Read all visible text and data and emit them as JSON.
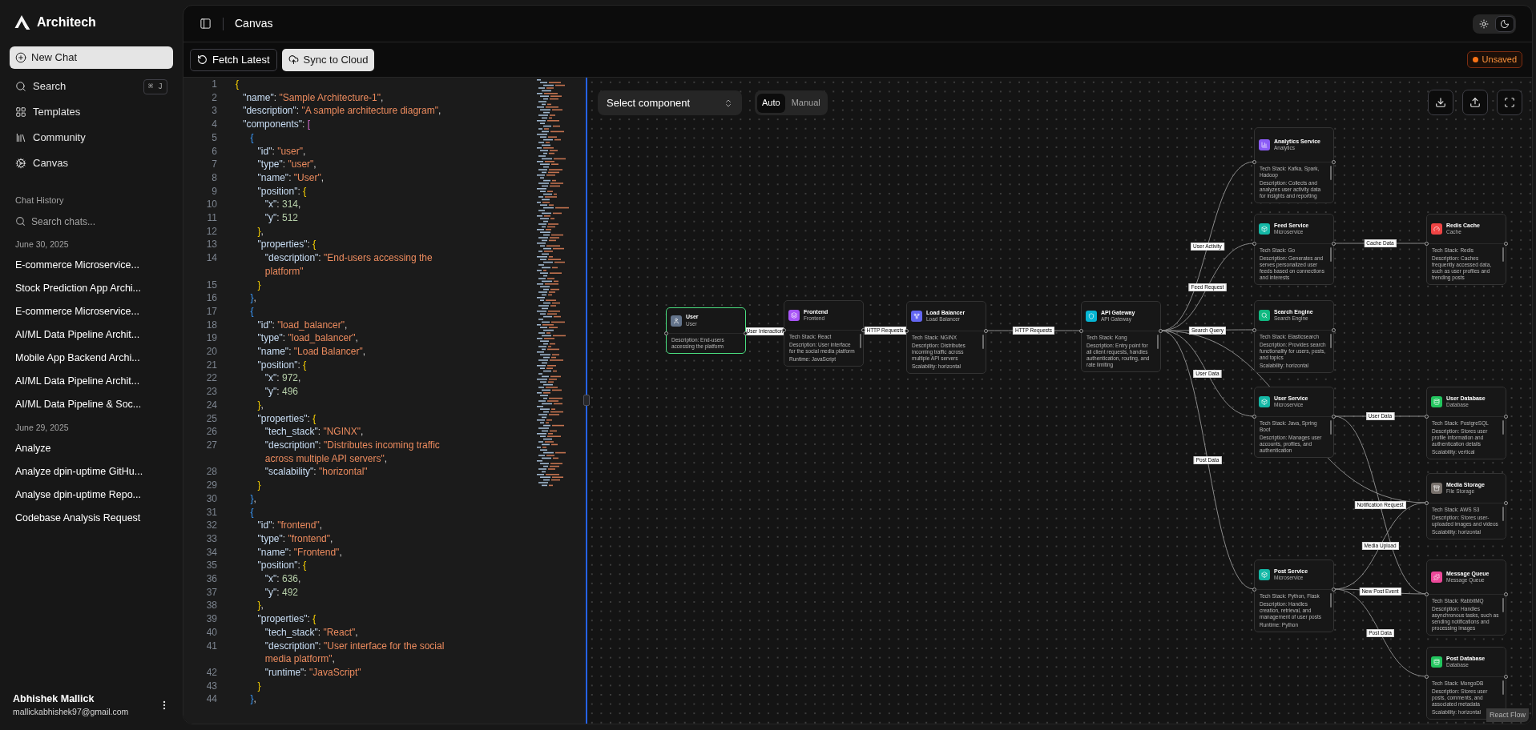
{
  "app": {
    "name": "Architech"
  },
  "sidebar": {
    "new_chat": "New Chat",
    "nav": [
      {
        "kind": "search",
        "label": "Search",
        "shortcut": "⌘ J"
      },
      {
        "kind": "templates",
        "label": "Templates"
      },
      {
        "kind": "community",
        "label": "Community"
      },
      {
        "kind": "canvas",
        "label": "Canvas"
      }
    ],
    "history_title": "Chat History",
    "search_placeholder": "Search chats...",
    "groups": [
      {
        "date": "June 30, 2025",
        "chats": [
          "E-commerce Microservice...",
          "Stock Prediction App Archi...",
          "E-commerce Microservice...",
          "AI/ML Data Pipeline Archit...",
          "Mobile App Backend Archi...",
          "AI/ML Data Pipeline Archit...",
          "AI/ML Data Pipeline & Soc..."
        ]
      },
      {
        "date": "June 29, 2025",
        "chats": [
          "Analyze",
          "Analyze dpin-uptime GitHu...",
          "Analyse dpin-uptime Repo...",
          "Codebase Analysis Request"
        ]
      }
    ],
    "user": {
      "name": "Abhishek Mallick",
      "email": "mallickabhishek97@gmail.com"
    }
  },
  "header": {
    "title": "Canvas",
    "theme_options": [
      {
        "kind": "light",
        "selected": false
      },
      {
        "kind": "dark",
        "selected": true
      }
    ]
  },
  "toolbar": {
    "buttons": [
      {
        "kind": "fetch",
        "label": "Fetch Latest",
        "primary": false
      },
      {
        "kind": "sync",
        "label": "Sync to Cloud",
        "primary": true
      }
    ],
    "status": "Unsaved"
  },
  "editor": {
    "lines": [
      {
        "n": "1",
        "text": "{"
      },
      {
        "n": "2",
        "text": "  \"name\": \"Sample Architecture-1\","
      },
      {
        "n": "3",
        "text": "  \"description\": \"A sample architecture diagram\","
      },
      {
        "n": "4",
        "text": "  \"components\": ["
      },
      {
        "n": "5",
        "text": "    {"
      },
      {
        "n": "6",
        "text": "      \"id\": \"user\","
      },
      {
        "n": "7",
        "text": "      \"type\": \"user\","
      },
      {
        "n": "8",
        "text": "      \"name\": \"User\","
      },
      {
        "n": "9",
        "text": "      \"position\": {"
      },
      {
        "n": "10",
        "text": "        \"x\": 314,"
      },
      {
        "n": "11",
        "text": "        \"y\": 512"
      },
      {
        "n": "12",
        "text": "      },"
      },
      {
        "n": "13",
        "text": "      \"properties\": {"
      },
      {
        "n": "14",
        "text": "        \"description\": \"End-users accessing the platform\""
      },
      {
        "n": "15",
        "text": "      }"
      },
      {
        "n": "16",
        "text": "    },"
      },
      {
        "n": "17",
        "text": "    {"
      },
      {
        "n": "18",
        "text": "      \"id\": \"load_balancer\","
      },
      {
        "n": "19",
        "text": "      \"type\": \"load_balancer\","
      },
      {
        "n": "20",
        "text": "      \"name\": \"Load Balancer\","
      },
      {
        "n": "21",
        "text": "      \"position\": {"
      },
      {
        "n": "22",
        "text": "        \"x\": 972,"
      },
      {
        "n": "23",
        "text": "        \"y\": 496"
      },
      {
        "n": "24",
        "text": "      },"
      },
      {
        "n": "25",
        "text": "      \"properties\": {"
      },
      {
        "n": "26",
        "text": "        \"tech_stack\": \"NGINX\","
      },
      {
        "n": "27",
        "text": "        \"description\": \"Distributes incoming traffic across multiple API servers\","
      },
      {
        "n": "28",
        "text": "        \"scalability\": \"horizontal\""
      },
      {
        "n": "29",
        "text": "      }"
      },
      {
        "n": "30",
        "text": "    },"
      },
      {
        "n": "31",
        "text": "    {"
      },
      {
        "n": "32",
        "text": "      \"id\": \"frontend\","
      },
      {
        "n": "33",
        "text": "      \"type\": \"frontend\","
      },
      {
        "n": "34",
        "text": "      \"name\": \"Frontend\","
      },
      {
        "n": "35",
        "text": "      \"position\": {"
      },
      {
        "n": "36",
        "text": "        \"x\": 636,"
      },
      {
        "n": "37",
        "text": "        \"y\": 492"
      },
      {
        "n": "38",
        "text": "      },"
      },
      {
        "n": "39",
        "text": "      \"properties\": {"
      },
      {
        "n": "40",
        "text": "        \"tech_stack\": \"React\","
      },
      {
        "n": "41",
        "text": "        \"description\": \"User interface for the social media platform\","
      },
      {
        "n": "42",
        "text": "        \"runtime\": \"JavaScript\""
      },
      {
        "n": "43",
        "text": "      }"
      },
      {
        "n": "44",
        "text": "    },"
      }
    ]
  },
  "canvas": {
    "component_select": {
      "placeholder": "Select component"
    },
    "layout_modes": [
      {
        "label": "Auto",
        "selected": true
      },
      {
        "label": "Manual",
        "selected": false
      }
    ],
    "nodes": [
      {
        "title": "User",
        "subtitle": "User",
        "kind": "user",
        "color": "#64748b",
        "selected": true,
        "details": [
          "Description: End-users accessing the platform"
        ]
      },
      {
        "title": "Frontend",
        "subtitle": "Frontend",
        "kind": "frontend",
        "color": "#a855f7",
        "selected": false,
        "details": [
          "Tech Stack: React",
          "Description: User interface for the social media platform",
          "Runtime: JavaScript"
        ]
      },
      {
        "title": "Load Balancer",
        "subtitle": "Load Balancer",
        "kind": "load_balancer",
        "color": "#6366f1",
        "selected": false,
        "details": [
          "Tech Stack: NGINX",
          "Description: Distributes incoming traffic across multiple API servers",
          "Scalability: horizontal"
        ]
      },
      {
        "title": "API Gateway",
        "subtitle": "API Gateway",
        "kind": "gateway",
        "color": "#06b6d4",
        "selected": false,
        "details": [
          "Tech Stack: Kong",
          "Description: Entry point for all client requests, handles authentication, routing, and rate limiting"
        ]
      },
      {
        "title": "Analytics Service",
        "subtitle": "Analytics",
        "kind": "analytics",
        "color": "#8b5cf6",
        "selected": false,
        "details": [
          "Tech Stack: Kafka, Spark, Hadoop",
          "Description: Collects and analyzes user activity data for insights and reporting"
        ]
      },
      {
        "title": "Feed Service",
        "subtitle": "Microservice",
        "kind": "microservice",
        "color": "#14b8a6",
        "selected": false,
        "details": [
          "Tech Stack: Go",
          "Description: Generates and serves personalized user feeds based on connections and interests"
        ]
      },
      {
        "title": "Search Engine",
        "subtitle": "Search Engine",
        "kind": "search",
        "color": "#10b981",
        "selected": false,
        "details": [
          "Tech Stack: Elasticsearch",
          "Description: Provides search functionality for users, posts, and topics",
          "Scalability: horizontal"
        ]
      },
      {
        "title": "User Service",
        "subtitle": "Microservice",
        "kind": "microservice",
        "color": "#14b8a6",
        "selected": false,
        "details": [
          "Tech Stack: Java, Spring Boot",
          "Description: Manages user accounts, profiles, and authentication"
        ]
      },
      {
        "title": "Post Service",
        "subtitle": "Microservice",
        "kind": "microservice",
        "color": "#14b8a6",
        "selected": false,
        "details": [
          "Tech Stack: Python, Flask",
          "Description: Handles creation, retrieval, and management of user posts",
          "Runtime: Python"
        ]
      },
      {
        "title": "Redis Cache",
        "subtitle": "Cache",
        "kind": "cache",
        "color": "#ef4444",
        "selected": false,
        "details": [
          "Tech Stack: Redis",
          "Description: Caches frequently accessed data, such as user profiles and trending posts"
        ]
      },
      {
        "title": "User Database",
        "subtitle": "Database",
        "kind": "database",
        "color": "#22c55e",
        "selected": false,
        "details": [
          "Tech Stack: PostgreSQL",
          "Description: Stores user profile information and authentication details",
          "Scalability: vertical"
        ]
      },
      {
        "title": "Media Storage",
        "subtitle": "File Storage",
        "kind": "storage",
        "color": "#78716c",
        "selected": false,
        "details": [
          "Tech Stack: AWS S3",
          "Description: Stores user-uploaded images and videos",
          "Scalability: horizontal"
        ]
      },
      {
        "title": "Message Queue",
        "subtitle": "Message Queue",
        "kind": "queue",
        "color": "#ec4899",
        "selected": false,
        "details": [
          "Tech Stack: RabbitMQ",
          "Description: Handles asynchronous tasks, such as sending notifications and processing images"
        ]
      },
      {
        "title": "Post Database",
        "subtitle": "Database",
        "kind": "database",
        "color": "#22c55e",
        "selected": false,
        "details": [
          "Tech Stack: MongoDB",
          "Description: Stores user posts, comments, and associated metadata",
          "Scalability: horizontal"
        ]
      }
    ],
    "edges": [
      {
        "label": "User Interaction"
      },
      {
        "label": "HTTP Requests"
      },
      {
        "label": "HTTP Requests"
      },
      {
        "label": "User Activity"
      },
      {
        "label": "Feed Request"
      },
      {
        "label": "Search Query"
      },
      {
        "label": "User Data"
      },
      {
        "label": "Post Data"
      },
      {
        "label": "Cache Data"
      },
      {
        "label": "User Data"
      },
      {
        "label": "Notification Request"
      },
      {
        "label": "Media Upload"
      },
      {
        "label": "New Post Event"
      },
      {
        "label": "Post Data"
      }
    ],
    "attribution": "React Flow"
  }
}
